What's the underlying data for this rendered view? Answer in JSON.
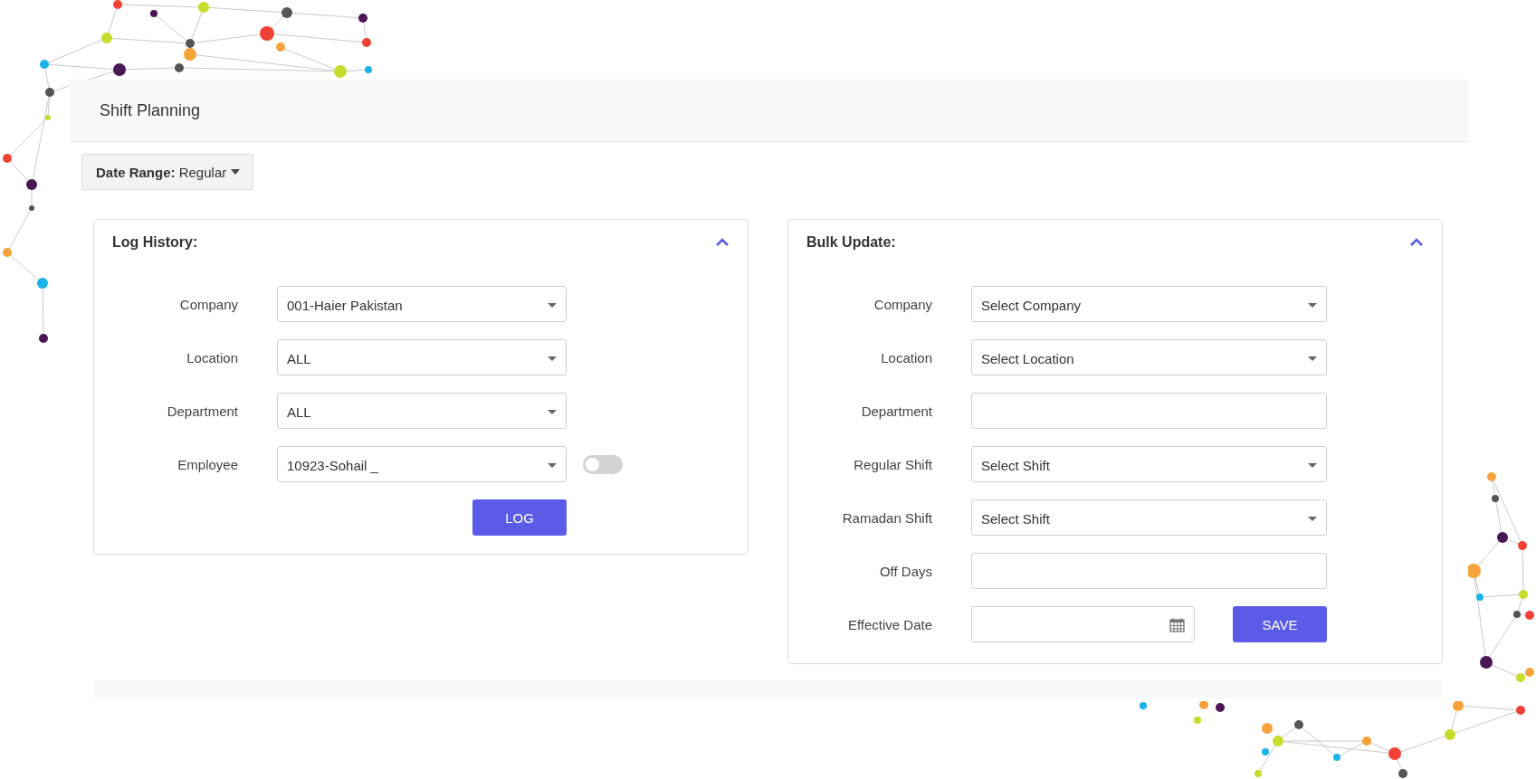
{
  "page": {
    "title": "Shift Planning"
  },
  "date_range": {
    "text": "**Date Range:** Regular"
  },
  "panels": [
    {
      "title": "Log History:",
      "expanded": true,
      "button": "LOG",
      "fields": [
        {
          "kind": "select",
          "label": "Company",
          "value": "001-Haier Pakistan"
        },
        {
          "kind": "select",
          "label": "Location",
          "value": "ALL"
        },
        {
          "kind": "select",
          "label": "Department",
          "value": "ALL"
        },
        {
          "kind": "select",
          "label": "Employee",
          "value": "10923-Sohail _",
          "toggle": {
            "on": false
          }
        }
      ]
    },
    {
      "title": "Bulk Update:",
      "expanded": true,
      "fields": [
        {
          "kind": "select",
          "label": "Company",
          "value": "Select Company"
        },
        {
          "kind": "select",
          "label": "Location",
          "value": "Select Location"
        },
        {
          "kind": "text",
          "label": "Department"
        },
        {
          "kind": "select",
          "label": "Regular Shift",
          "value": "Select Shift"
        },
        {
          "kind": "select",
          "label": "Ramadan Shift",
          "value": "Select Shift"
        },
        {
          "kind": "text",
          "label": "Off Days"
        },
        {
          "kind": "date",
          "label": "Effective Date",
          "button": "SAVE"
        }
      ]
    }
  ]
}
